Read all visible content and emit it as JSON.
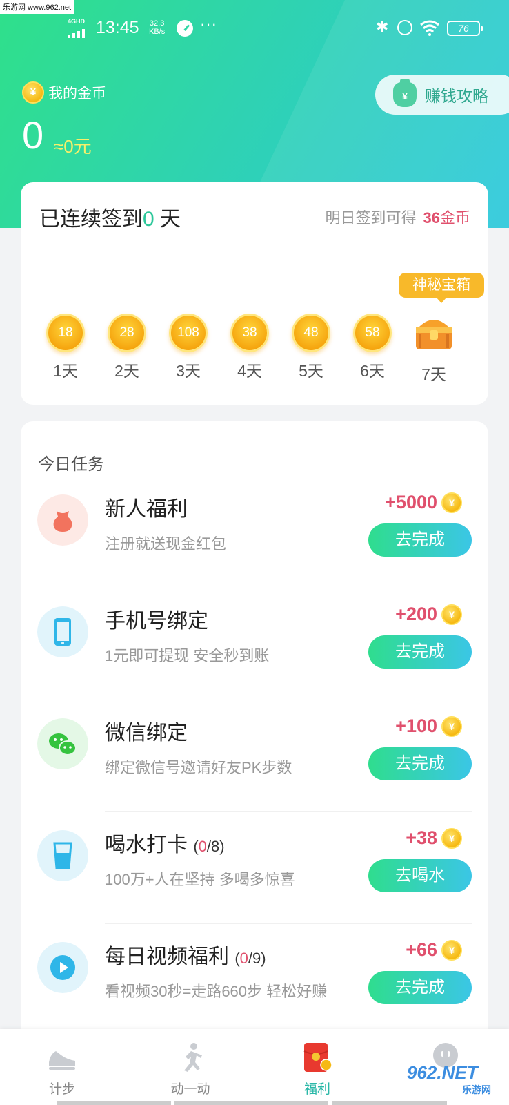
{
  "watermark": "乐游网 www.962.net",
  "status": {
    "network": "4GHD",
    "time": "13:45",
    "speed_value": "32.3",
    "speed_unit": "KB/s",
    "more": "···",
    "battery": "76"
  },
  "header": {
    "coin_icon": "¥",
    "coin_label": "我的金币",
    "coin_value": "0",
    "coin_money": "≈0元",
    "earn_button": "赚钱攻略",
    "bag_icon": "¥"
  },
  "signin": {
    "title_prefix": "已连续签到",
    "days_count": "0",
    "title_suffix": " 天",
    "tomorrow_label": "明日签到可得",
    "tomorrow_reward": "36",
    "tomorrow_unit": "金币",
    "mystery_box": "神秘宝箱",
    "days": [
      {
        "value": "18",
        "label": "1天"
      },
      {
        "value": "28",
        "label": "2天"
      },
      {
        "value": "108",
        "label": "3天"
      },
      {
        "value": "38",
        "label": "4天"
      },
      {
        "value": "48",
        "label": "5天"
      },
      {
        "value": "58",
        "label": "6天"
      },
      {
        "value": "",
        "label": "7天",
        "icon": "treasure-chest-icon"
      }
    ]
  },
  "tasks": {
    "header": "今日任务",
    "items": [
      {
        "title": "新人福利",
        "progress_done": "",
        "progress_total": "",
        "desc": "注册就送现金红包",
        "reward": "+5000",
        "button": "去完成",
        "icon": "gift-bag-icon"
      },
      {
        "title": "手机号绑定",
        "progress_done": "",
        "progress_total": "",
        "desc": "1元即可提现 安全秒到账",
        "reward": "+200",
        "button": "去完成",
        "icon": "phone-icon"
      },
      {
        "title": "微信绑定",
        "progress_done": "",
        "progress_total": "",
        "desc": "绑定微信号邀请好友PK步数",
        "reward": "+100",
        "button": "去完成",
        "icon": "wechat-icon"
      },
      {
        "title": "喝水打卡",
        "progress_done": "0",
        "progress_total": "/8)",
        "desc": "100万+人在坚持 多喝多惊喜",
        "reward": "+38",
        "button": "去喝水",
        "icon": "water-cup-icon"
      },
      {
        "title": "每日视频福利",
        "progress_done": "0",
        "progress_total": "/9)",
        "desc": "看视频30秒=走路660步 轻松好赚",
        "reward": "+66",
        "button": "去完成",
        "icon": "play-icon"
      }
    ]
  },
  "tabbar": {
    "items": [
      {
        "label": "计步",
        "icon": "shoe-icon"
      },
      {
        "label": "动一动",
        "icon": "running-man-icon"
      },
      {
        "label": "福利",
        "icon": "red-envelope-icon",
        "active": true
      },
      {
        "label": "",
        "icon": "profile-icon"
      }
    ]
  },
  "site_badge": {
    "main": "962.NET",
    "sub": "乐游网"
  },
  "colors": {
    "accent_green": "#2fdd8e",
    "accent_red": "#e0506d",
    "coin_gold": "#f6b913"
  }
}
